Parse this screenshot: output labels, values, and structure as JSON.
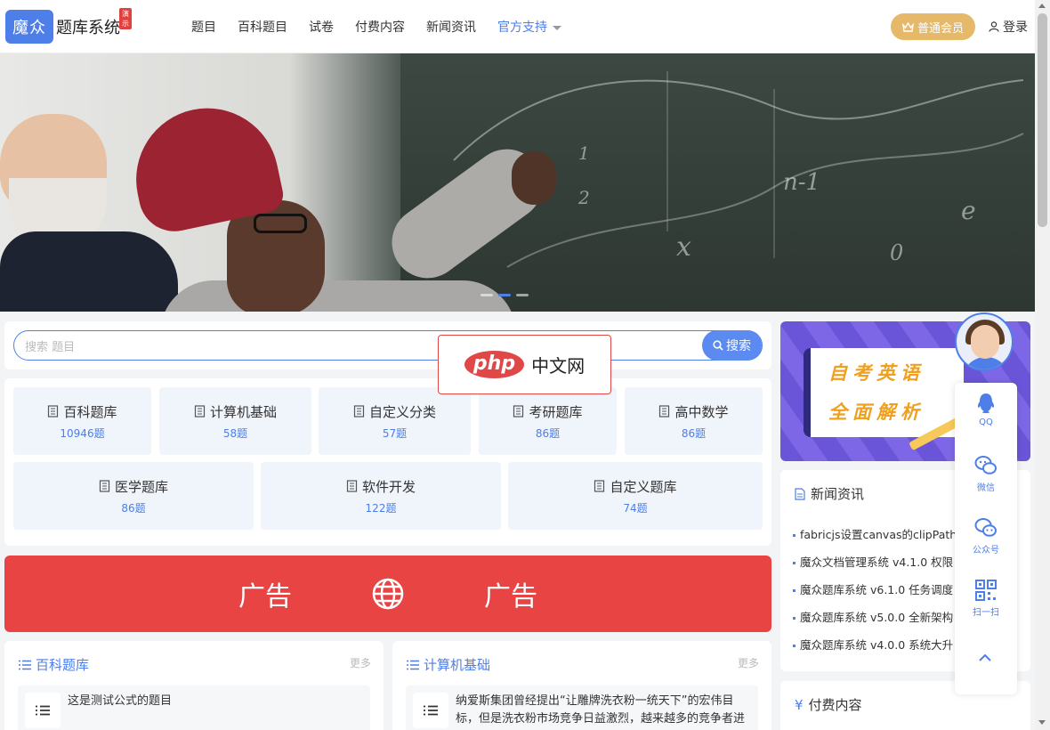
{
  "header": {
    "logo_box": "魔众",
    "logo_text": "题库系统",
    "logo_badge": "演示",
    "nav": [
      {
        "label": "题目"
      },
      {
        "label": "百科题目"
      },
      {
        "label": "试卷"
      },
      {
        "label": "付费内容"
      },
      {
        "label": "新闻资讯"
      },
      {
        "label": "官方支持"
      }
    ],
    "vip_label": "普通会员",
    "login_label": "登录"
  },
  "banner": {
    "chalk": [
      "n-1",
      "1",
      "2",
      "x",
      "0",
      "e"
    ]
  },
  "search": {
    "placeholder": "搜索 题目",
    "button": "搜索"
  },
  "categories": [
    {
      "name": "百科题库",
      "count": "10946题"
    },
    {
      "name": "计算机基础",
      "count": "58题"
    },
    {
      "name": "自定义分类",
      "count": "57题"
    },
    {
      "name": "考研题库",
      "count": "86题"
    },
    {
      "name": "高中数学",
      "count": "86题"
    },
    {
      "name": "医学题库",
      "count": "86题"
    },
    {
      "name": "软件开发",
      "count": "122题"
    },
    {
      "name": "自定义题库",
      "count": "74题"
    }
  ],
  "ad": {
    "left": "广告",
    "right": "广告"
  },
  "lists": [
    {
      "title": "百科题库",
      "more": "更多",
      "item": "这是测试公式的题目"
    },
    {
      "title": "计算机基础",
      "more": "更多",
      "item": "纳爱斯集团曾经提出“让雕牌洗衣粉一统天下”的宏伟目标，但是洗衣粉市场竞争日益激烈，越来越多的竞争者进"
    }
  ],
  "promo": {
    "line1": "自考英语",
    "line2": "全面解析"
  },
  "news": {
    "title": "新闻资讯",
    "items": [
      "fabricjs设置canvas的clipPath后",
      "魔众文档管理系统 v4.1.0 权限",
      "魔众题库系统 v6.1.0 任务调度",
      "魔众题库系统 v5.0.0 全新架构",
      "魔众题库系统 v4.0.0 系统大升"
    ]
  },
  "paid": {
    "yen": "¥",
    "title": "付费内容"
  },
  "float": {
    "qq": "QQ",
    "wechat": "微信",
    "gzh": "公众号",
    "scan": "扫一扫"
  },
  "watermark": {
    "logo": "php",
    "text": "中文网"
  },
  "colors": {
    "accent": "#4e7ee8",
    "ad": "#e84444",
    "vip": "#e6b86a"
  }
}
